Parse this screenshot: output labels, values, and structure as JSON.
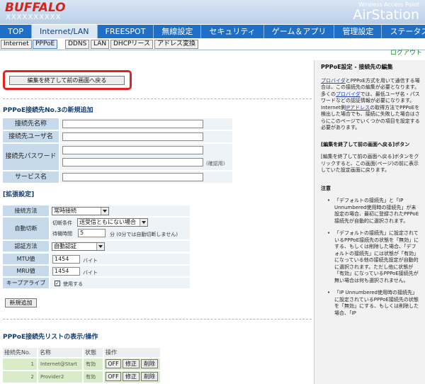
{
  "header": {
    "logo": "BUFFALO",
    "model": "XXXXXXXXXX",
    "brand_sub": "Wireless Access Point",
    "brand": "AirStation"
  },
  "nav": [
    "TOP",
    "Internet/LAN",
    "FREESPOT",
    "無線設定",
    "セキュリティ",
    "ゲーム＆アプリ",
    "管理設定",
    "ステータス"
  ],
  "subnav": [
    "Internet",
    "PPPoE",
    "DDNS",
    "LAN",
    "DHCPリース",
    "アドレス変換"
  ],
  "logout": "ログアウト",
  "back_button": "編集を終了して前の画面へ戻る",
  "new_entry": {
    "title": "PPPoE接続先No.3の新規追加",
    "labels": {
      "name": "接続先名称",
      "user": "接続先ユーザ名",
      "password": "接続先パスワード",
      "service": "サービス名"
    },
    "confirm_note": "(確認用)"
  },
  "extended": {
    "title": "[拡張設定]",
    "labels": {
      "connection": "接続方法",
      "auto_disconnect": "自動切断",
      "auth": "認証方法",
      "mtu": "MTU値",
      "mru": "MRU値",
      "keepalive": "キープアライブ"
    },
    "connection_value": "常時接続",
    "cut_condition_label": "切断条件",
    "cut_condition_value": "送受信ともにない場合",
    "wait_label": "待機時間",
    "wait_value": "5",
    "wait_note": "分 (0分では自動切断しません)",
    "auth_value": "自動認証",
    "mtu_value": "1454",
    "mru_value": "1454",
    "unit": "バイト",
    "keepalive_label": "使用する",
    "keepalive_checked": "✓"
  },
  "add_button": "新規追加",
  "list": {
    "title": "PPPoE接続先リストの表示/操作",
    "headers": [
      "接続先No.",
      "名称",
      "状態",
      "操作"
    ],
    "rows": [
      {
        "no": "1",
        "name": "Internet@Start",
        "state": "有効",
        "off": "OFF",
        "edit": "修正",
        "del": "削除"
      },
      {
        "no": "2",
        "name": "Provider2",
        "state": "有効",
        "off": "OFF",
        "edit": "修正",
        "del": "削除"
      }
    ]
  },
  "sidebar": {
    "title": "PPPoE設定 - 接続先の編集",
    "p1_link1": "プロバイダ",
    "p1_t1": "とPPPoE方式を用いて通信する場合は、この接続先の編集が必要となります。多くの",
    "p1_link2": "プロバイダ",
    "p1_t2": "では、最低ユーザ名・パスワードなどの認証情報が必要になります。Internet側",
    "p1_link3": "IPアドレス",
    "p1_t3": "の取得方法でPPPoEを検出した場合でも、接続に失敗した場合はさらにこのページでいくつかの項目を設定する必要があります。",
    "h2": "[編集を終了して前の画面へ戻る]ボタン",
    "p2": "[編集を終了して前の画面へ戻る]ボタンをクリックすると、この画面(ページ)の前に表示していた設定画面に戻ります。",
    "h3": "注意",
    "b1": "「デフォルトの接続先」と「IP Unnumbered使用時の接続先」が未設定の場合、最初に登録されたPPPoE接続先が自動的に選択されます。",
    "b2": "「デフォルトの接続先」に設定されているPPPoE接続先の状態を「無効」にする、もしくは削除した場合、「デフォルトの接続先」には状態が「有効」になっている他の接続先設定が自動的に選択されます。ただし他に状態が「有効」になっているPPPoE接続先が無い場合は何も選択されません。",
    "b3": "「IP Unnumbered使用時の接続先」に設定されているPPPoE接続先の状態を「無効」にする、もしくは削除した場合、「IP"
  }
}
